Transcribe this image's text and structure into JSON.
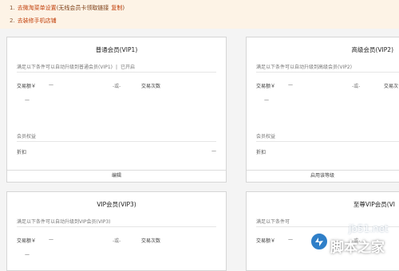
{
  "tips": {
    "item1": {
      "num": "1.",
      "text": "去微淘菜单设置",
      "paren": "(无线会员卡领取链接",
      "copy": "复制",
      "close": ")"
    },
    "item2": {
      "num": "2.",
      "text": "去装修手机店铺"
    }
  },
  "cards": [
    {
      "title": "普通会员(VIP1)",
      "condition": "满足以下条件可以自动升级到普通会员(VIP1)",
      "status": "已开启",
      "amount_label": "交易额￥",
      "amount_value": "—",
      "or": "-或-",
      "count_label": "交易次数",
      "extra_value": "—",
      "rights_label": "会员权益",
      "discount_label": "折扣",
      "discount_value": "—",
      "action": "编辑"
    },
    {
      "title": "高级会员(VIP2)",
      "condition": "满足以下条件可以自动升级到高级会员(VIP2)",
      "amount_label": "交易额￥",
      "amount_value": "—",
      "or": "-或-",
      "count_label": "交易次",
      "extra_value": "—",
      "rights_label": "会员权益",
      "discount_label": "折扣",
      "action": "启用该等级"
    },
    {
      "title": "VIP会员(VIP3)",
      "condition": "满足以下条件可以自动升级到VIP会员(VIP3)",
      "amount_label": "交易额￥",
      "amount_value": "—",
      "or": "-或-",
      "count_label": "交易次数",
      "extra_value": "—"
    },
    {
      "title": "至尊VIP会员(VI",
      "condition": "满足以下条件可",
      "amount_label": "交易额￥",
      "amount_value": "—",
      "or": "-或-"
    }
  ],
  "watermark": {
    "site": "jb51.net",
    "brand": "脚本之家"
  },
  "colors": {
    "tip_bg": "#fdf3e6",
    "tip_text": "#c2410c",
    "card_border": "#d6d6d6",
    "page_bg": "#f4f4f4"
  }
}
